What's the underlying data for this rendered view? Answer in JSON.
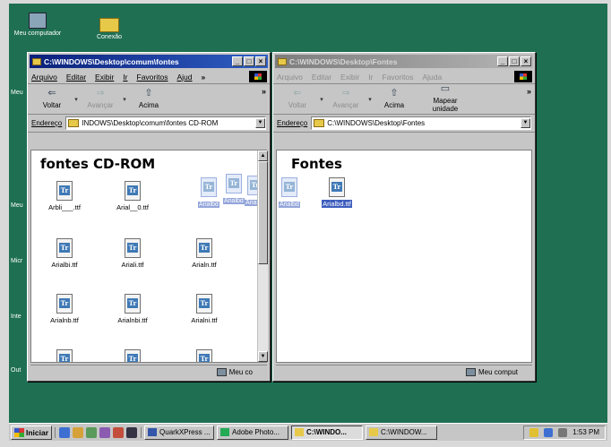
{
  "desktop": {
    "icons": [
      {
        "label": "Meu computador"
      },
      {
        "label": "Conexão"
      }
    ],
    "partial_labels": [
      "Meu",
      "Meu",
      "Micr",
      "Inte",
      "Out"
    ]
  },
  "window_left": {
    "title": "C:\\WINDOWS\\Desktop\\comum\\fontes",
    "menu": [
      "Arquivo",
      "Editar",
      "Exibir",
      "Ir",
      "Favoritos",
      "Ajud"
    ],
    "toolbar": [
      "Voltar",
      "Avançar",
      "Acima"
    ],
    "address_label": "Endereço",
    "address_value": "INDOWS\\Desktop\\comum\\fontes CD-ROM",
    "heading": "fontes CD-ROM",
    "files": [
      "Arbli___.ttf",
      "Arial__0.ttf",
      "Arialbi.ttf",
      "Ariali.ttf",
      "Arialn.ttf",
      "Arialnb.ttf",
      "Arialnbi.ttf",
      "Arialni.ttf"
    ],
    "drag_labels": [
      "Arialbd",
      "Arialbd",
      "Arialbd"
    ],
    "status": "Meu co"
  },
  "window_right": {
    "title": "C:\\WINDOWS\\Desktop\\Fontes",
    "menu": [
      "Arquivo",
      "Editar",
      "Exibir",
      "Ir",
      "Favoritos",
      "Ajuda"
    ],
    "toolbar": [
      "Voltar",
      "Avançar",
      "Acima",
      "Mapear unidade"
    ],
    "address_label": "Endereço",
    "address_value": "C:\\WINDOWS\\Desktop\\Fontes",
    "heading": "Fontes",
    "drag_labels": [
      "Arialbd",
      "Arialbd.ttf"
    ],
    "status": "Meu comput"
  },
  "taskbar": {
    "start": "Iniciar",
    "tasks": [
      "QuarkXPress ...",
      "Adobe Photo...",
      "C:\\WINDO...",
      "C:\\WINDOW..."
    ],
    "clock": "1:53 PM"
  },
  "colors": {
    "desktop": "#1f6f53",
    "titlebar_active": "#0a1f7a",
    "titlebar_inactive": "#7d7d7d"
  }
}
